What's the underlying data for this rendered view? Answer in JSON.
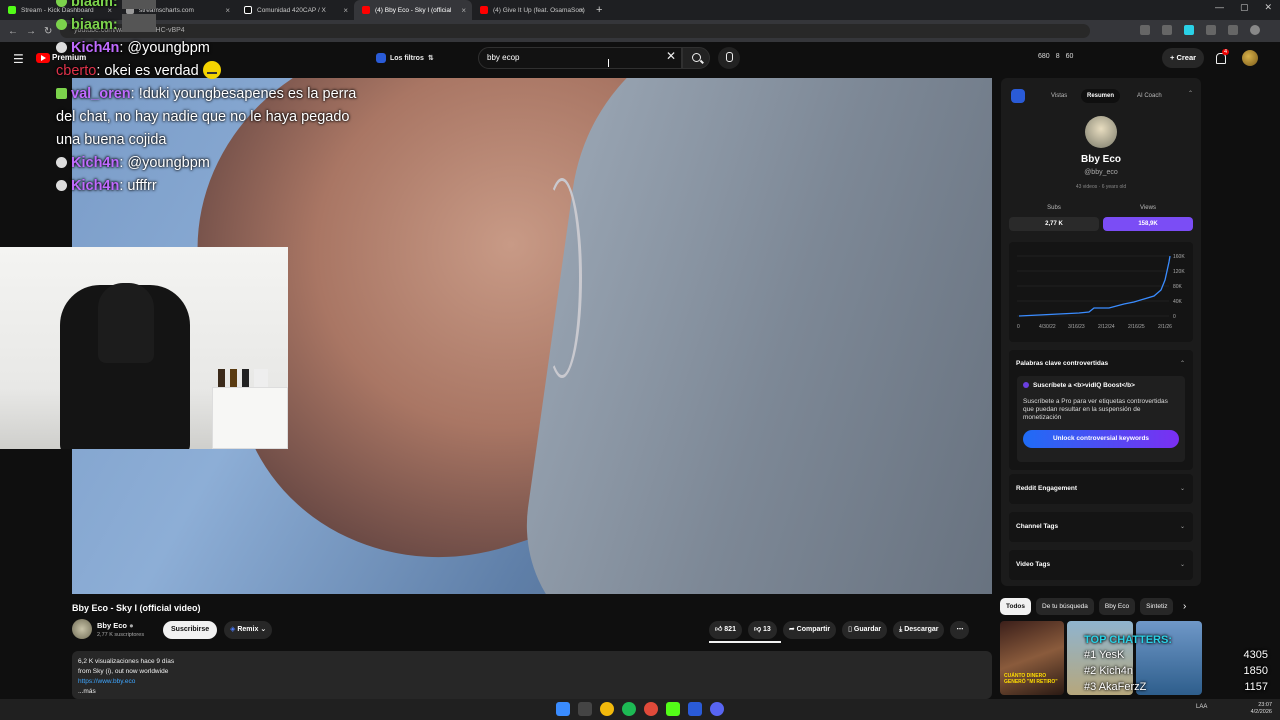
{
  "browser": {
    "tabs": [
      {
        "label": "Stream - Kick Dashboard",
        "color": "#53fc18"
      },
      {
        "label": "streamscharts.com",
        "color": "#9a9a9a"
      },
      {
        "label": "Comunidad 420CAP / X",
        "color": "#ffffff"
      },
      {
        "label": "(4) Bby Eco - Sky I (official",
        "color": "#ff0000"
      },
      {
        "label": "(4) Give It Up (feat. OsamaSon)",
        "color": "#ff0000"
      }
    ],
    "url": "youtube.com/watch?v=...7HC-vBP4"
  },
  "header": {
    "premium_label": "Premium",
    "filters_label": "Los filtros",
    "search_value": "bby ecop",
    "stats": [
      "680",
      "8",
      "60"
    ],
    "create_label": "Crear",
    "notif_count": "4"
  },
  "chat": [
    {
      "user": "biaam:",
      "text": "",
      "color": "#7cd34c",
      "thumb": true
    },
    {
      "user": "biaam:",
      "text": "",
      "color": "#7cd34c",
      "thumb": true
    },
    {
      "user": "Kich4n",
      "text": ": @youngbpm",
      "color": "#c06bff"
    },
    {
      "user": "cberto",
      "text": ": okei es verdad",
      "color": "#e0334b",
      "emoji": true
    },
    {
      "user": "val_oren",
      "text": ": !duki youngbesapenes es la perra del chat, no hay nadie que no le haya pegado una buena cojida",
      "color": "#c06bff"
    },
    {
      "user": "Kich4n",
      "text": ": @youngbpm",
      "color": "#c06bff"
    },
    {
      "user": "Kich4n",
      "text": ": ufffrr",
      "color": "#c06bff"
    }
  ],
  "video": {
    "title": "Bby Eco - Sky I (official video)",
    "channel": "Bby Eco",
    "subs": "2,77 K suscriptores",
    "subscribe_label": "Suscribirse",
    "remix_label": "Remix",
    "likes": "821",
    "dislikes": "13",
    "share_label": "Compartir",
    "save_label": "Guardar",
    "download_label": "Descargar",
    "desc_line1": "6,2 K visualizaciones  hace 9 días",
    "desc_line2": "from Sky (i), out now worldwide",
    "desc_link": "https://www.bby.eco",
    "desc_more": "...más"
  },
  "panel": {
    "tabs": [
      "Vistas",
      "Resumen",
      "AI Coach"
    ],
    "channel_name": "Bby Eco",
    "handle": "@bby_eco",
    "meta": "43 videos · 6 years old",
    "subs_label": "Subs",
    "subs_value": "2,77 K",
    "views_label": "Views",
    "views_value": "158,9K",
    "chart_y_ticks": [
      "160K",
      "120K",
      "80K",
      "40K",
      "0"
    ],
    "chart_x_ticks": [
      "0",
      "4/30/22",
      "3/16/23",
      "2/12/24",
      "2/16/25",
      "2/1/26"
    ],
    "keywords_title": "Palabras clave controvertidas",
    "kw_promo_title": "Suscríbete a <b>vidIQ Boost</b>",
    "kw_promo_text": "Suscríbete a Pro para ver etiquetas controvertidas que puedan resultar en la suspensión de monetización",
    "kw_button": "Unlock controversial keywords",
    "sections": [
      "Reddit Engagement",
      "Channel Tags",
      "Video Tags"
    ]
  },
  "chips": [
    "Todos",
    "De tu búsqueda",
    "Bby Eco",
    "Sintetiz"
  ],
  "rec_text": "CUÁNTO DINERO GENERÓ \"MI RETIRO\"",
  "top_chatters": {
    "title": "TOP CHATTERS:",
    "rows": [
      {
        "rank": "#1",
        "name": "YesK",
        "score": "4305"
      },
      {
        "rank": "#2",
        "name": "Kich4n",
        "score": "1850"
      },
      {
        "rank": "#3",
        "name": "AkaFerzZ",
        "score": "1157"
      }
    ]
  },
  "taskbar": {
    "lang": "LAA",
    "time": "23:07",
    "date": "4/2/2026"
  }
}
